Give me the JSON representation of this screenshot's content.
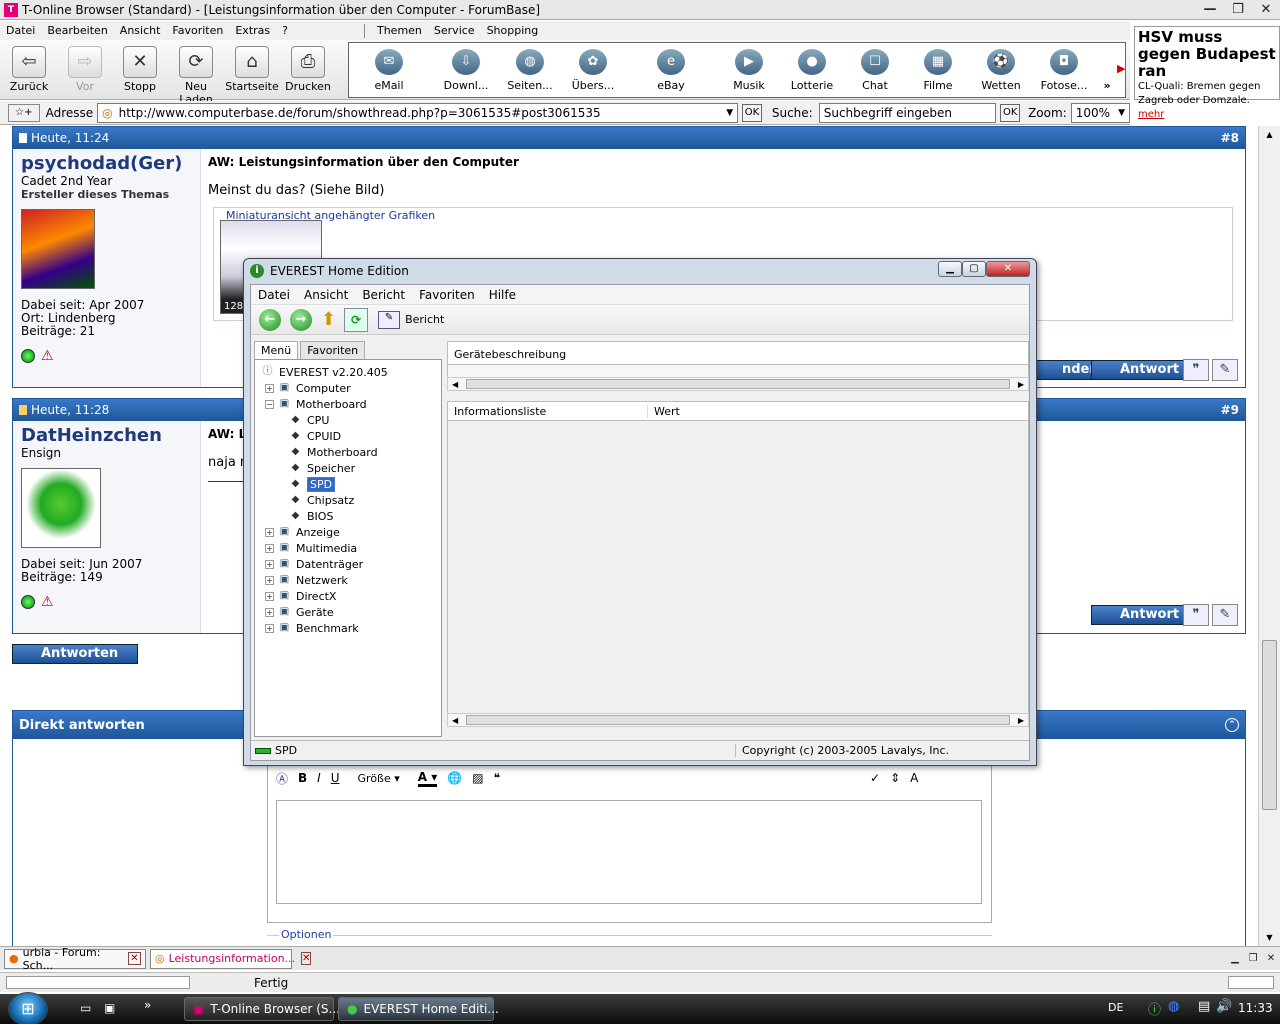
{
  "window": {
    "title": "T-Online Browser (Standard) - [Leistungsinformation über den Computer - ForumBase]"
  },
  "menubar": {
    "left": [
      "Datei",
      "Bearbeiten",
      "Ansicht",
      "Favoriten",
      "Extras",
      "?"
    ],
    "right": [
      "Themen",
      "Service",
      "Shopping"
    ]
  },
  "toolbar": {
    "nav": [
      {
        "label": "Zurück",
        "icon": "arrow-left"
      },
      {
        "label": "Vor",
        "icon": "arrow-right"
      },
      {
        "label": "Stopp",
        "icon": "x-mark"
      },
      {
        "label": "Neu Laden",
        "icon": "refresh"
      },
      {
        "label": "Startseite",
        "icon": "home"
      },
      {
        "label": "Drucken",
        "icon": "printer"
      }
    ],
    "services": [
      "eMail",
      "Downl...",
      "Seiten...",
      "Übers...",
      "eBay",
      "Musik",
      "Lotterie",
      "Chat",
      "Filme",
      "Wetten",
      "Fotose..."
    ],
    "more": "»"
  },
  "ad": {
    "headline": "HSV muss gegen Budapest ran",
    "text": "CL-Quali: Bremen gegen Zagreb oder Domzale.",
    "link": "mehr"
  },
  "address": {
    "label": "Adresse",
    "url": "http://www.computerbase.de/forum/showthread.php?p=3061535#post3061535",
    "ok": "OK",
    "search_label": "Suche:",
    "search_placeholder": "Suchbegriff eingeben",
    "zoom_label": "Zoom:",
    "zoom_value": "100%"
  },
  "posts": [
    {
      "date": "Heute, 11:24",
      "num": "#8",
      "user": "psychodad(Ger)",
      "rank": "Cadet 2nd Year",
      "starter": "Ersteller dieses Themas",
      "joined": "Dabei seit: Apr 2007",
      "location": "Ort: Lindenberg",
      "count": "Beiträge: 21",
      "title": "AW: Leistungsinformation über den Computer",
      "body": "Meinst du das? (Siehe Bild)",
      "attach": "Miniaturansicht angehängter Grafiken",
      "thumb_caption": "128",
      "btn_edit": "ndern",
      "btn_reply": "Antwort"
    },
    {
      "date": "Heute, 11:28",
      "num": "#9",
      "user": "DatHeinzchen",
      "rank": "Ensign",
      "joined": "Dabei seit: Jun 2007",
      "count": "Beiträge: 149",
      "title": "AW: L",
      "body": "naja n",
      "btn_reply": "Antwort"
    }
  ],
  "reply_button": "Antworten",
  "quick_reply": {
    "title": "Direkt antworten",
    "size_label": "Größe",
    "options": "Optionen"
  },
  "everest": {
    "title": "EVEREST Home Edition",
    "menu": [
      "Datei",
      "Ansicht",
      "Bericht",
      "Favoriten",
      "Hilfe"
    ],
    "report": "Bericht",
    "tabs": [
      "Menü",
      "Favoriten"
    ],
    "tree": [
      {
        "label": "EVEREST v2.20.405",
        "level": 0,
        "exp": ""
      },
      {
        "label": "Computer",
        "level": 1,
        "exp": "+"
      },
      {
        "label": "Motherboard",
        "level": 1,
        "exp": "−"
      },
      {
        "label": "CPU",
        "level": 2,
        "exp": ""
      },
      {
        "label": "CPUID",
        "level": 2,
        "exp": ""
      },
      {
        "label": "Motherboard",
        "level": 2,
        "exp": ""
      },
      {
        "label": "Speicher",
        "level": 2,
        "exp": ""
      },
      {
        "label": "SPD",
        "level": 2,
        "exp": "",
        "selected": true
      },
      {
        "label": "Chipsatz",
        "level": 2,
        "exp": ""
      },
      {
        "label": "BIOS",
        "level": 2,
        "exp": ""
      },
      {
        "label": "Anzeige",
        "level": 1,
        "exp": "+"
      },
      {
        "label": "Multimedia",
        "level": 1,
        "exp": "+"
      },
      {
        "label": "Datenträger",
        "level": 1,
        "exp": "+"
      },
      {
        "label": "Netzwerk",
        "level": 1,
        "exp": "+"
      },
      {
        "label": "DirectX",
        "level": 1,
        "exp": "+"
      },
      {
        "label": "Geräte",
        "level": 1,
        "exp": "+"
      },
      {
        "label": "Benchmark",
        "level": 1,
        "exp": "+"
      }
    ],
    "device_desc": "Gerätebeschreibung",
    "col1": "Informationsliste",
    "col2": "Wert",
    "status_left": "SPD",
    "status_right": "Copyright (c) 2003-2005 Lavalys, Inc."
  },
  "tabs_bottom": [
    {
      "label": "urbia - Forum: Sch..."
    },
    {
      "label": "Leistungsinformation..."
    }
  ],
  "status": "Fertig",
  "taskbar": {
    "tasks": [
      "T-Online Browser (S...",
      "EVEREST Home Editi..."
    ],
    "lang": "DE",
    "time": "11:33"
  }
}
